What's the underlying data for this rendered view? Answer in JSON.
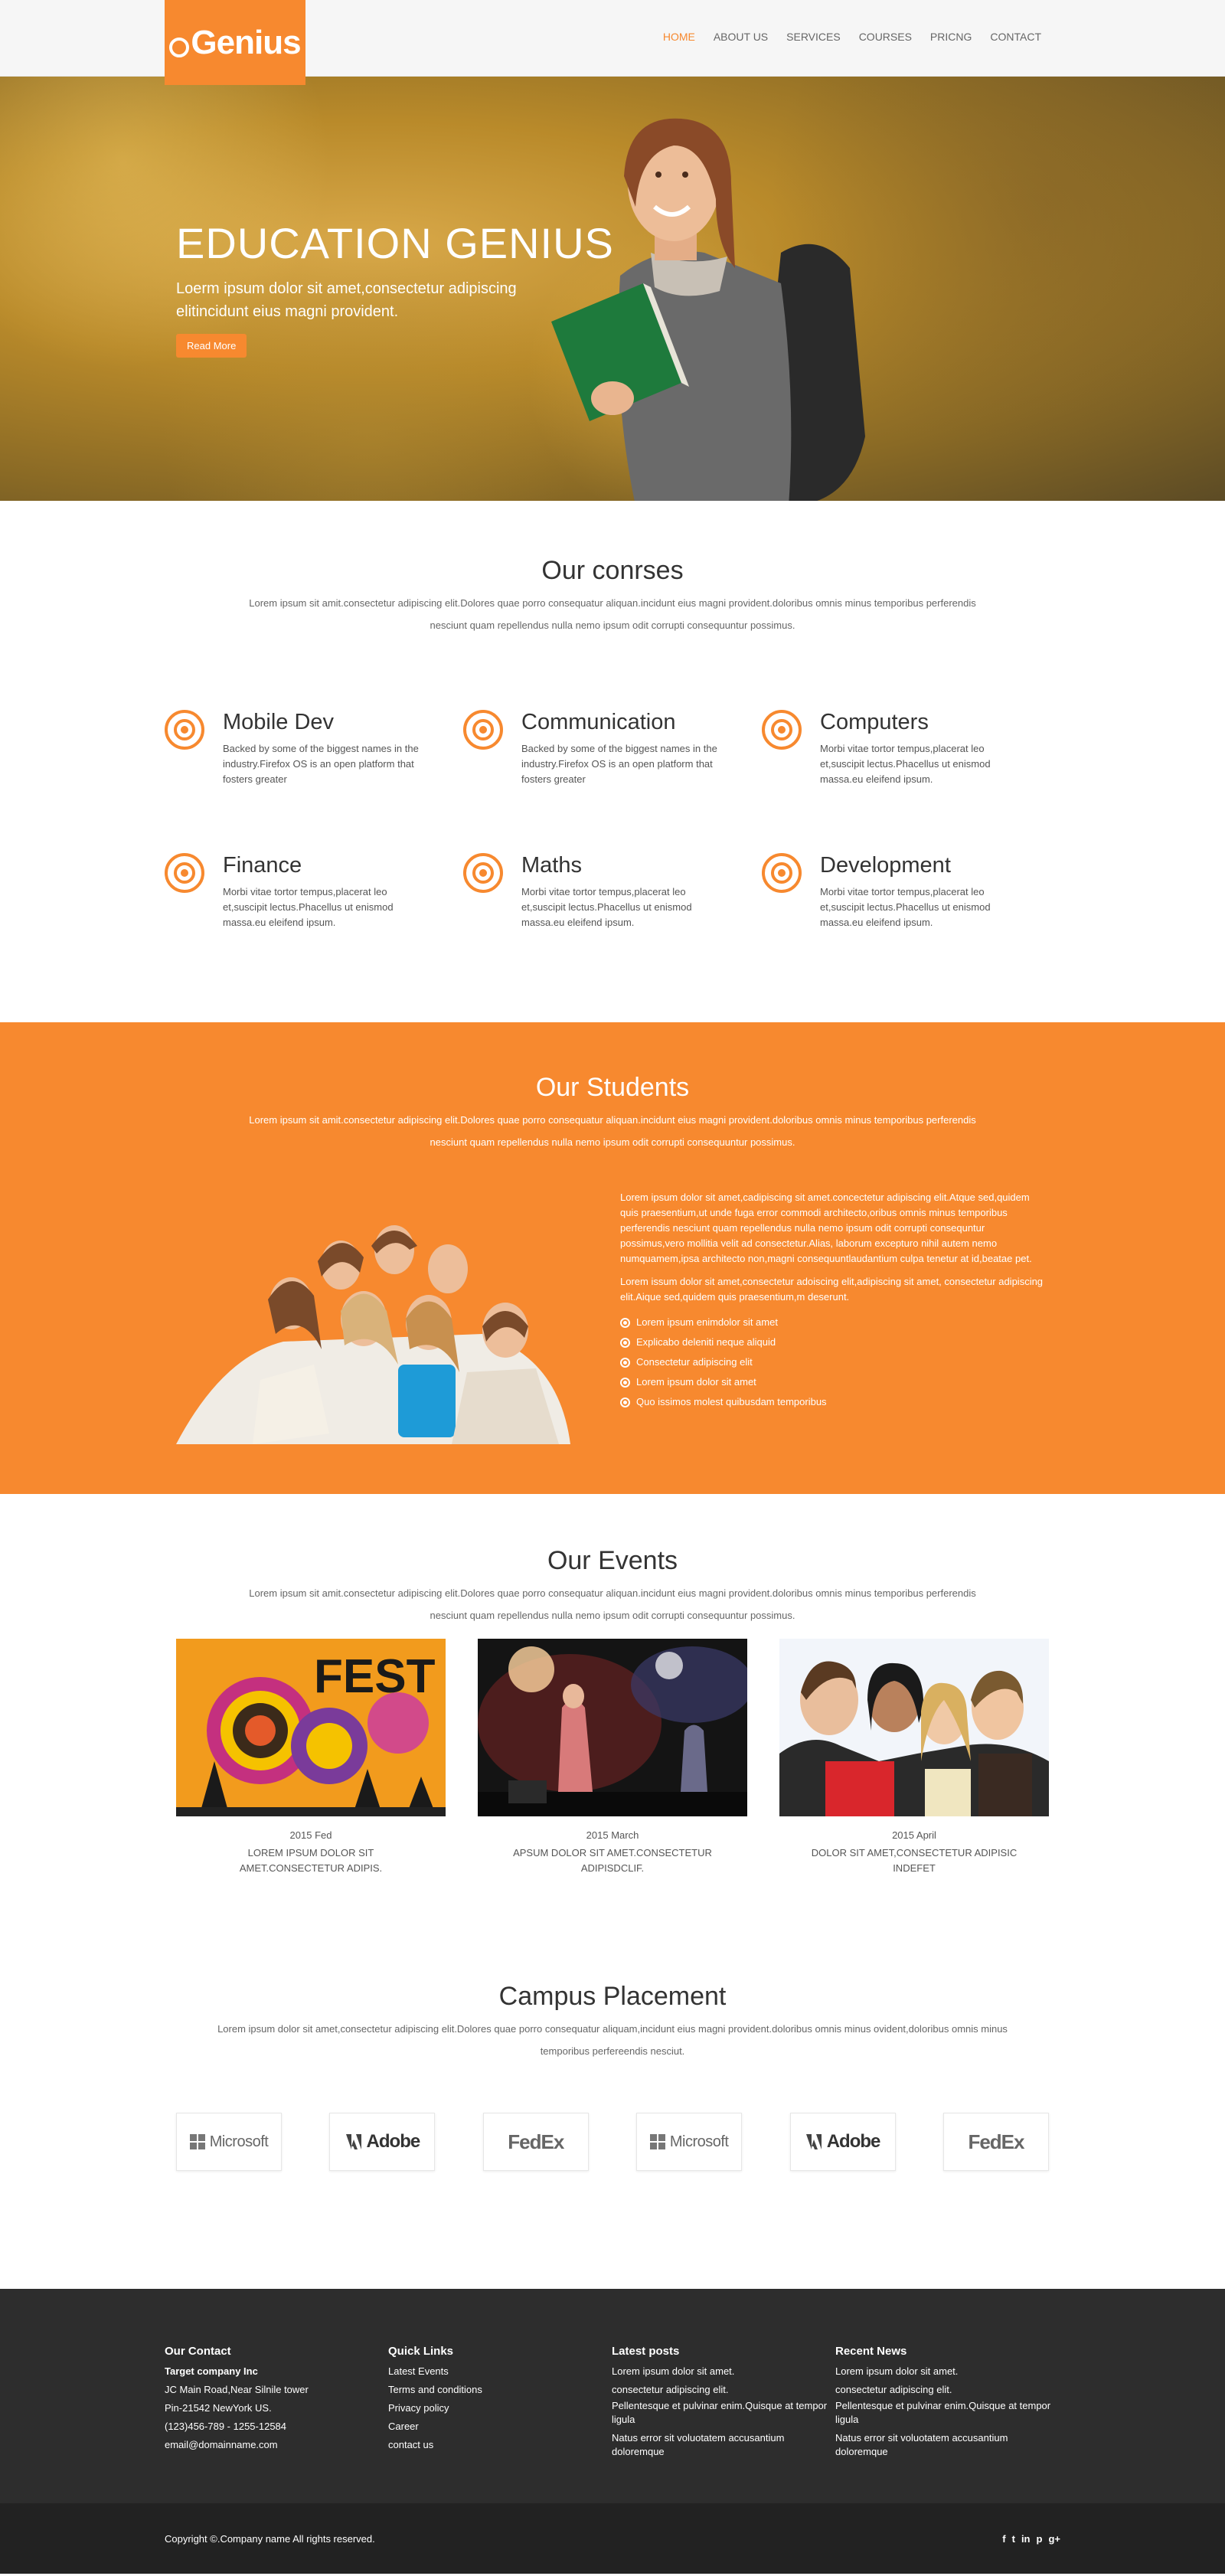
{
  "header": {
    "logo_text": "Genius",
    "nav": [
      "HOME",
      "ABOUT US",
      "SERVICES",
      "COURSES",
      "PRICNG",
      "CONTACT"
    ],
    "colors": {
      "accent": "#f7892f"
    }
  },
  "hero": {
    "title": "EDUCATION GENIUS",
    "subtitle": "Loerm ipsum dolor sit amet,consectetur adipiscing elitincidunt eius magni provident.",
    "button": "Read More"
  },
  "courses": {
    "title": "Our conrses",
    "text": "Lorem ipsum sit amit.consectetur adipiscing elit.Dolores quae porro consequatur aliquan.incidunt eius magni provident.doloribus omnis minus temporibus perferendis nesciunt quam repellendus nulla nemo ipsum odit corrupti consequuntur possimus.",
    "items": [
      {
        "title": "Mobile Dev",
        "desc": "Backed by some of the biggest names in the industry.Firefox OS is an open platform that fosters greater"
      },
      {
        "title": "Communication",
        "desc": "Backed by some of the biggest names in the industry.Firefox OS is an open platform that fosters greater"
      },
      {
        "title": "Computers",
        "desc": "Morbi vitae tortor tempus,placerat leo et,suscipit lectus.Phacellus ut enismod massa.eu eleifend ipsum."
      },
      {
        "title": "Finance",
        "desc": "Morbi vitae tortor tempus,placerat leo et,suscipit lectus.Phacellus ut enismod massa.eu eleifend ipsum."
      },
      {
        "title": "Maths",
        "desc": "Morbi vitae tortor tempus,placerat leo et,suscipit lectus.Phacellus ut enismod massa.eu eleifend ipsum."
      },
      {
        "title": "Development",
        "desc": "Morbi vitae tortor tempus,placerat leo et,suscipit lectus.Phacellus ut enismod massa.eu eleifend ipsum."
      }
    ]
  },
  "students": {
    "title": "Our Students",
    "text": "Lorem ipsum sit amit.consectetur adipiscing elit.Dolores quae porro consequatur aliquan.incidunt eius magni provident.doloribus omnis minus temporibus perferendis nesciunt quam repellendus nulla nemo ipsum odit corrupti consequuntur possimus.",
    "para1": "Lorem ipsum dolor sit amet,cadipiscing sit amet.concectetur adipiscing elit.Atque sed,quidem quis praesentium,ut unde fuga error commodi architecto,oribus omnis minus temporibus perferendis nesciunt quam repellendus nulla nemo ipsum odit corrupti consequntur possimus,vero mollitia velit ad consectetur.Alias, laborum excepturo nihil autem nemo numquamem,ipsa architecto non,magni consequuntlaudantium culpa tenetur at id,beatae pet.",
    "para2": "Lorem issum dolor sit amet,consectetur adoiscing elit,adipiscing sit amet, consectetur adipiscing elit.Aique sed,quidem quis praesentium,m deserunt.",
    "bullets": [
      "Lorem ipsum enimdolor sit amet",
      "Explicabo deleniti neque aliquid",
      "Consectetur adipiscing elit",
      "Lorem ipsum dolor sit amet",
      "Quo issimos molest quibusdam temporibus"
    ]
  },
  "events": {
    "title": "Our Events",
    "text": "Lorem ipsum sit amit.consectetur adipiscing elit.Dolores quae porro consequatur aliquan.incidunt eius magni provident.doloribus omnis minus temporibus perferendis nesciunt quam repellendus nulla nemo ipsum odit corrupti consequuntur possimus.",
    "items": [
      {
        "date": "2015 Fed",
        "caption": "LOREM IPSUM DOLOR SIT AMET.CONSECTETUR ADIPIS.",
        "image_text": "FEST"
      },
      {
        "date": "2015 March",
        "caption": "APSUM DOLOR SIT AMET.CONSECTETUR ADIPISDCLIF.",
        "image_text": ""
      },
      {
        "date": "2015 April",
        "caption": "DOLOR SIT AMET,CONSECTETUR ADIPISIC INDEFET",
        "image_text": ""
      }
    ]
  },
  "campus": {
    "title": "Campus Placement",
    "text": "Lorem ipsum dolor sit amet,consectetur adipiscing elit.Dolores quae porro consequatur aliquam,incidunt eius magni provident.doloribus omnis minus ovident,doloribus omnis minus temporibus perfereendis nesciut.",
    "logos": [
      "Microsoft",
      "Adobe",
      "FedEx",
      "Microsoft",
      "Adobe",
      "FedEx"
    ]
  },
  "footer": {
    "contact": {
      "title": "Our Contact",
      "company": "Target company Inc",
      "lines": [
        "JC Main Road,Near Silnile tower",
        "Pin-21542 NewYork US.",
        "(123)456-789 - 1255-12584",
        "email@domainname.com"
      ]
    },
    "quick": {
      "title": "Quick Links",
      "links": [
        "Latest Events",
        "Terms and conditions",
        "Privacy policy",
        "Career",
        "contact us"
      ]
    },
    "posts": {
      "title": "Latest posts",
      "items": [
        "Lorem ipsum dolor sit amet.",
        "consectetur adipiscing elit.",
        "Pellentesque et pulvinar enim.Quisque at tempor ligula",
        "Natus error sit voluotatem accusantium doloremque"
      ]
    },
    "news": {
      "title": "Recent News",
      "items": [
        "Lorem ipsum dolor sit amet.",
        "consectetur adipiscing elit.",
        "Pellentesque et pulvinar enim.Quisque at tempor ligula",
        "Natus error sit voluotatem accusantium doloremque"
      ]
    },
    "copyright": "Copyright ©.Company name All rights reserved.",
    "socials": [
      "f",
      "t",
      "in",
      "p",
      "g+"
    ]
  }
}
